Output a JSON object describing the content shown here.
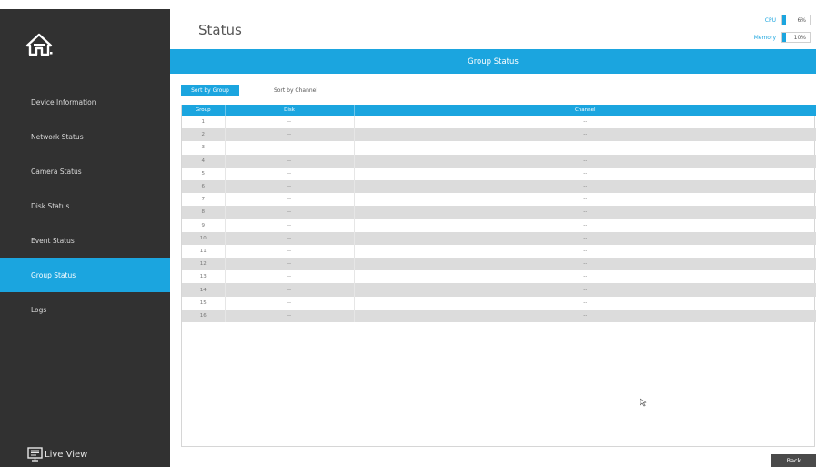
{
  "header": {
    "title": "Status",
    "cpu": {
      "label": "CPU",
      "value": "6%",
      "percent": 6
    },
    "memory": {
      "label": "Memory",
      "value": "10%",
      "percent": 10
    }
  },
  "sidebar": {
    "home_icon": "home-icon",
    "items": [
      {
        "label": "Device Information",
        "active": false
      },
      {
        "label": "Network Status",
        "active": false
      },
      {
        "label": "Camera Status",
        "active": false
      },
      {
        "label": "Disk Status",
        "active": false
      },
      {
        "label": "Event Status",
        "active": false
      },
      {
        "label": "Group Status",
        "active": true
      },
      {
        "label": "Logs",
        "active": false
      }
    ],
    "live_view": {
      "label": "Live View",
      "icon": "monitor-icon"
    }
  },
  "main": {
    "banner": "Group Status",
    "tabs": [
      {
        "label": "Sort by Group",
        "active": true
      },
      {
        "label": "Sort by Channel",
        "active": false
      }
    ],
    "table": {
      "columns": [
        "Group",
        "Disk",
        "Channel"
      ],
      "rows": [
        [
          "1",
          "--",
          "--"
        ],
        [
          "2",
          "--",
          "--"
        ],
        [
          "3",
          "--",
          "--"
        ],
        [
          "4",
          "--",
          "--"
        ],
        [
          "5",
          "--",
          "--"
        ],
        [
          "6",
          "--",
          "--"
        ],
        [
          "7",
          "--",
          "--"
        ],
        [
          "8",
          "--",
          "--"
        ],
        [
          "9",
          "--",
          "--"
        ],
        [
          "10",
          "--",
          "--"
        ],
        [
          "11",
          "--",
          "--"
        ],
        [
          "12",
          "--",
          "--"
        ],
        [
          "13",
          "--",
          "--"
        ],
        [
          "14",
          "--",
          "--"
        ],
        [
          "15",
          "--",
          "--"
        ],
        [
          "16",
          "--",
          "--"
        ]
      ]
    }
  },
  "footer": {
    "back_label": "Back"
  },
  "colors": {
    "accent": "#1ba5df",
    "sidebar_bg": "#313131",
    "row_alt": "#dcdcdc"
  }
}
